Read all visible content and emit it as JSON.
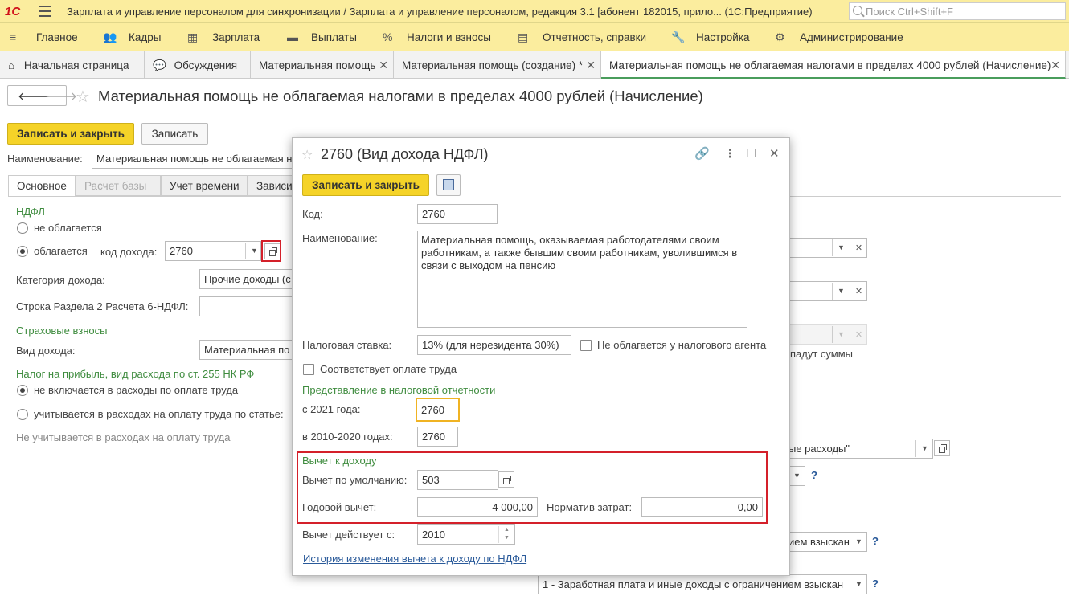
{
  "app": {
    "logo": "1С",
    "title": "Зарплата и управление персоналом для синхронизации / Зарплата и управление персоналом, редакция 3.1 [абонент 182015, прило...  (1С:Предприятие)",
    "search_placeholder": "Поиск Ctrl+Shift+F"
  },
  "menu": {
    "items": [
      {
        "label": "Главное",
        "icon": "≡"
      },
      {
        "label": "Кадры",
        "icon": "👥"
      },
      {
        "label": "Зарплата",
        "icon": "▦"
      },
      {
        "label": "Выплаты",
        "icon": "▬"
      },
      {
        "label": "Налоги и взносы",
        "icon": "%"
      },
      {
        "label": "Отчетность, справки",
        "icon": "▤"
      },
      {
        "label": "Настройка",
        "icon": "🔧"
      },
      {
        "label": "Администрирование",
        "icon": "⚙"
      }
    ]
  },
  "tabs": [
    {
      "label": "Начальная страница",
      "icon": "⌂",
      "closable": false
    },
    {
      "label": "Обсуждения",
      "icon": "💬",
      "closable": false
    },
    {
      "label": "Материальная помощь",
      "closable": true
    },
    {
      "label": "Материальная помощь (создание) *",
      "closable": true
    },
    {
      "label": "Материальная помощь не облагаемая налогами в пределах 4000 рублей (Начисление)",
      "closable": true
    }
  ],
  "doc": {
    "title": "Материальная помощь не облагаемая налогами в пределах 4000 рублей (Начисление)",
    "save_close": "Записать и закрыть",
    "save": "Записать",
    "name_label": "Наименование:",
    "name_value": "Материальная помощь не облагаемая налогами в пределах 4000 рублей",
    "subtabs": [
      "Основное",
      "Расчет базы",
      "Учет времени",
      "Зависим"
    ],
    "ndfl_header": "НДФЛ",
    "radio_not_taxed": "не облагается",
    "radio_taxed": "облагается",
    "income_code_label": "код дохода:",
    "income_code_value": "2760",
    "income_category_label": "Категория дохода:",
    "income_category_value": "Прочие доходы (с",
    "report_line_label": "Строка Раздела 2 Расчета 6-НДФЛ:",
    "insurance_header": "Страховые взносы",
    "income_type_label": "Вид дохода:",
    "income_type_value": "Материальная по",
    "profit_tax_header": "Налог на прибыль, вид расхода по ст. 255 НК РФ",
    "radio_not_included": "не включается в расходы по оплате труда",
    "radio_included": "учитывается в расходах на оплату труда по статье:",
    "not_included_note": "Не учитывается в расходах на оплату труда",
    "right_text_1": "падут суммы",
    "right_field_expenses": "ые расходы\"",
    "right_field_deductions_1": "ием взыскан",
    "right_field_deductions_2": "1 - Заработная плата и иные доходы с ограничением взыскан",
    "qmark": "?"
  },
  "modal": {
    "title": "2760 (Вид дохода НДФЛ)",
    "save_close": "Записать и закрыть",
    "code_label": "Код:",
    "code_value": "2760",
    "name_label": "Наименование:",
    "name_value": "Материальная помощь, оказываемая работодателями своим работникам, а также бывшим своим работникам, уволившимся в связи с выходом на пенсию",
    "rate_label": "Налоговая ставка:",
    "rate_value": "13% (для нерезидента 30%)",
    "not_taxed_agent": "Не облагается у налогового агента",
    "labor_payment": "Соответствует оплате труда",
    "reporting_header": "Представление в налоговой отчетности",
    "since_2021_label": "с 2021 года:",
    "since_2021_value": "2760",
    "y2010_2020_label": "в 2010-2020 годах:",
    "y2010_2020_value": "2760",
    "deduction_header": "Вычет к доходу",
    "default_deduction_label": "Вычет по умолчанию:",
    "default_deduction_value": "503",
    "annual_deduction_label": "Годовой вычет:",
    "annual_deduction_value": "4 000,00",
    "cost_norm_label": "Норматив затрат:",
    "cost_norm_value": "0,00",
    "deduction_since_label": "Вычет действует с:",
    "deduction_since_value": "2010",
    "history_link": "История изменения вычета к доходу по НДФЛ"
  },
  "colors": {
    "header_bg": "#fbed9e",
    "accent_yellow": "#f5d328",
    "highlight_red": "#d4202a",
    "group_green": "#3f8c3f",
    "focus_orange": "#f0b323"
  }
}
